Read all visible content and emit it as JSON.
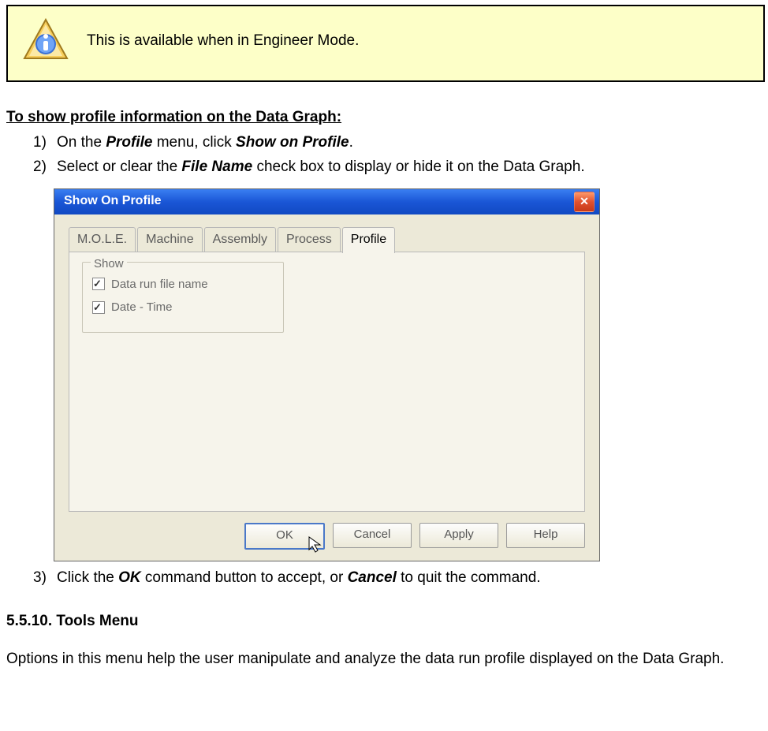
{
  "note": {
    "text": "This is available when in Engineer Mode."
  },
  "heading": "To show profile information on the Data Graph:",
  "steps": {
    "s1": {
      "prefix": "On the ",
      "b1": "Profile",
      "mid": " menu, click ",
      "b2": "Show on Profile",
      "suffix": "."
    },
    "s2": {
      "prefix": "Select or clear the ",
      "b1": "File Name",
      "suffix": " check box to display or hide it on the Data Graph."
    },
    "s3": {
      "prefix": "Click the ",
      "b1": "OK",
      "mid": " command button to accept, or ",
      "b2": "Cancel",
      "suffix": " to quit the command."
    }
  },
  "dialog": {
    "title": "Show On Profile",
    "tabs": [
      "M.O.L.E.",
      "Machine",
      "Assembly",
      "Process",
      "Profile"
    ],
    "group_legend": "Show",
    "checks": [
      "Data run file name",
      "Date - Time"
    ],
    "buttons": {
      "ok": "OK",
      "cancel": "Cancel",
      "apply": "Apply",
      "help": "Help"
    }
  },
  "section": {
    "title": "5.5.10. Tools Menu",
    "para": "Options in this menu help the user manipulate and analyze the data run profile displayed on the Data Graph."
  }
}
